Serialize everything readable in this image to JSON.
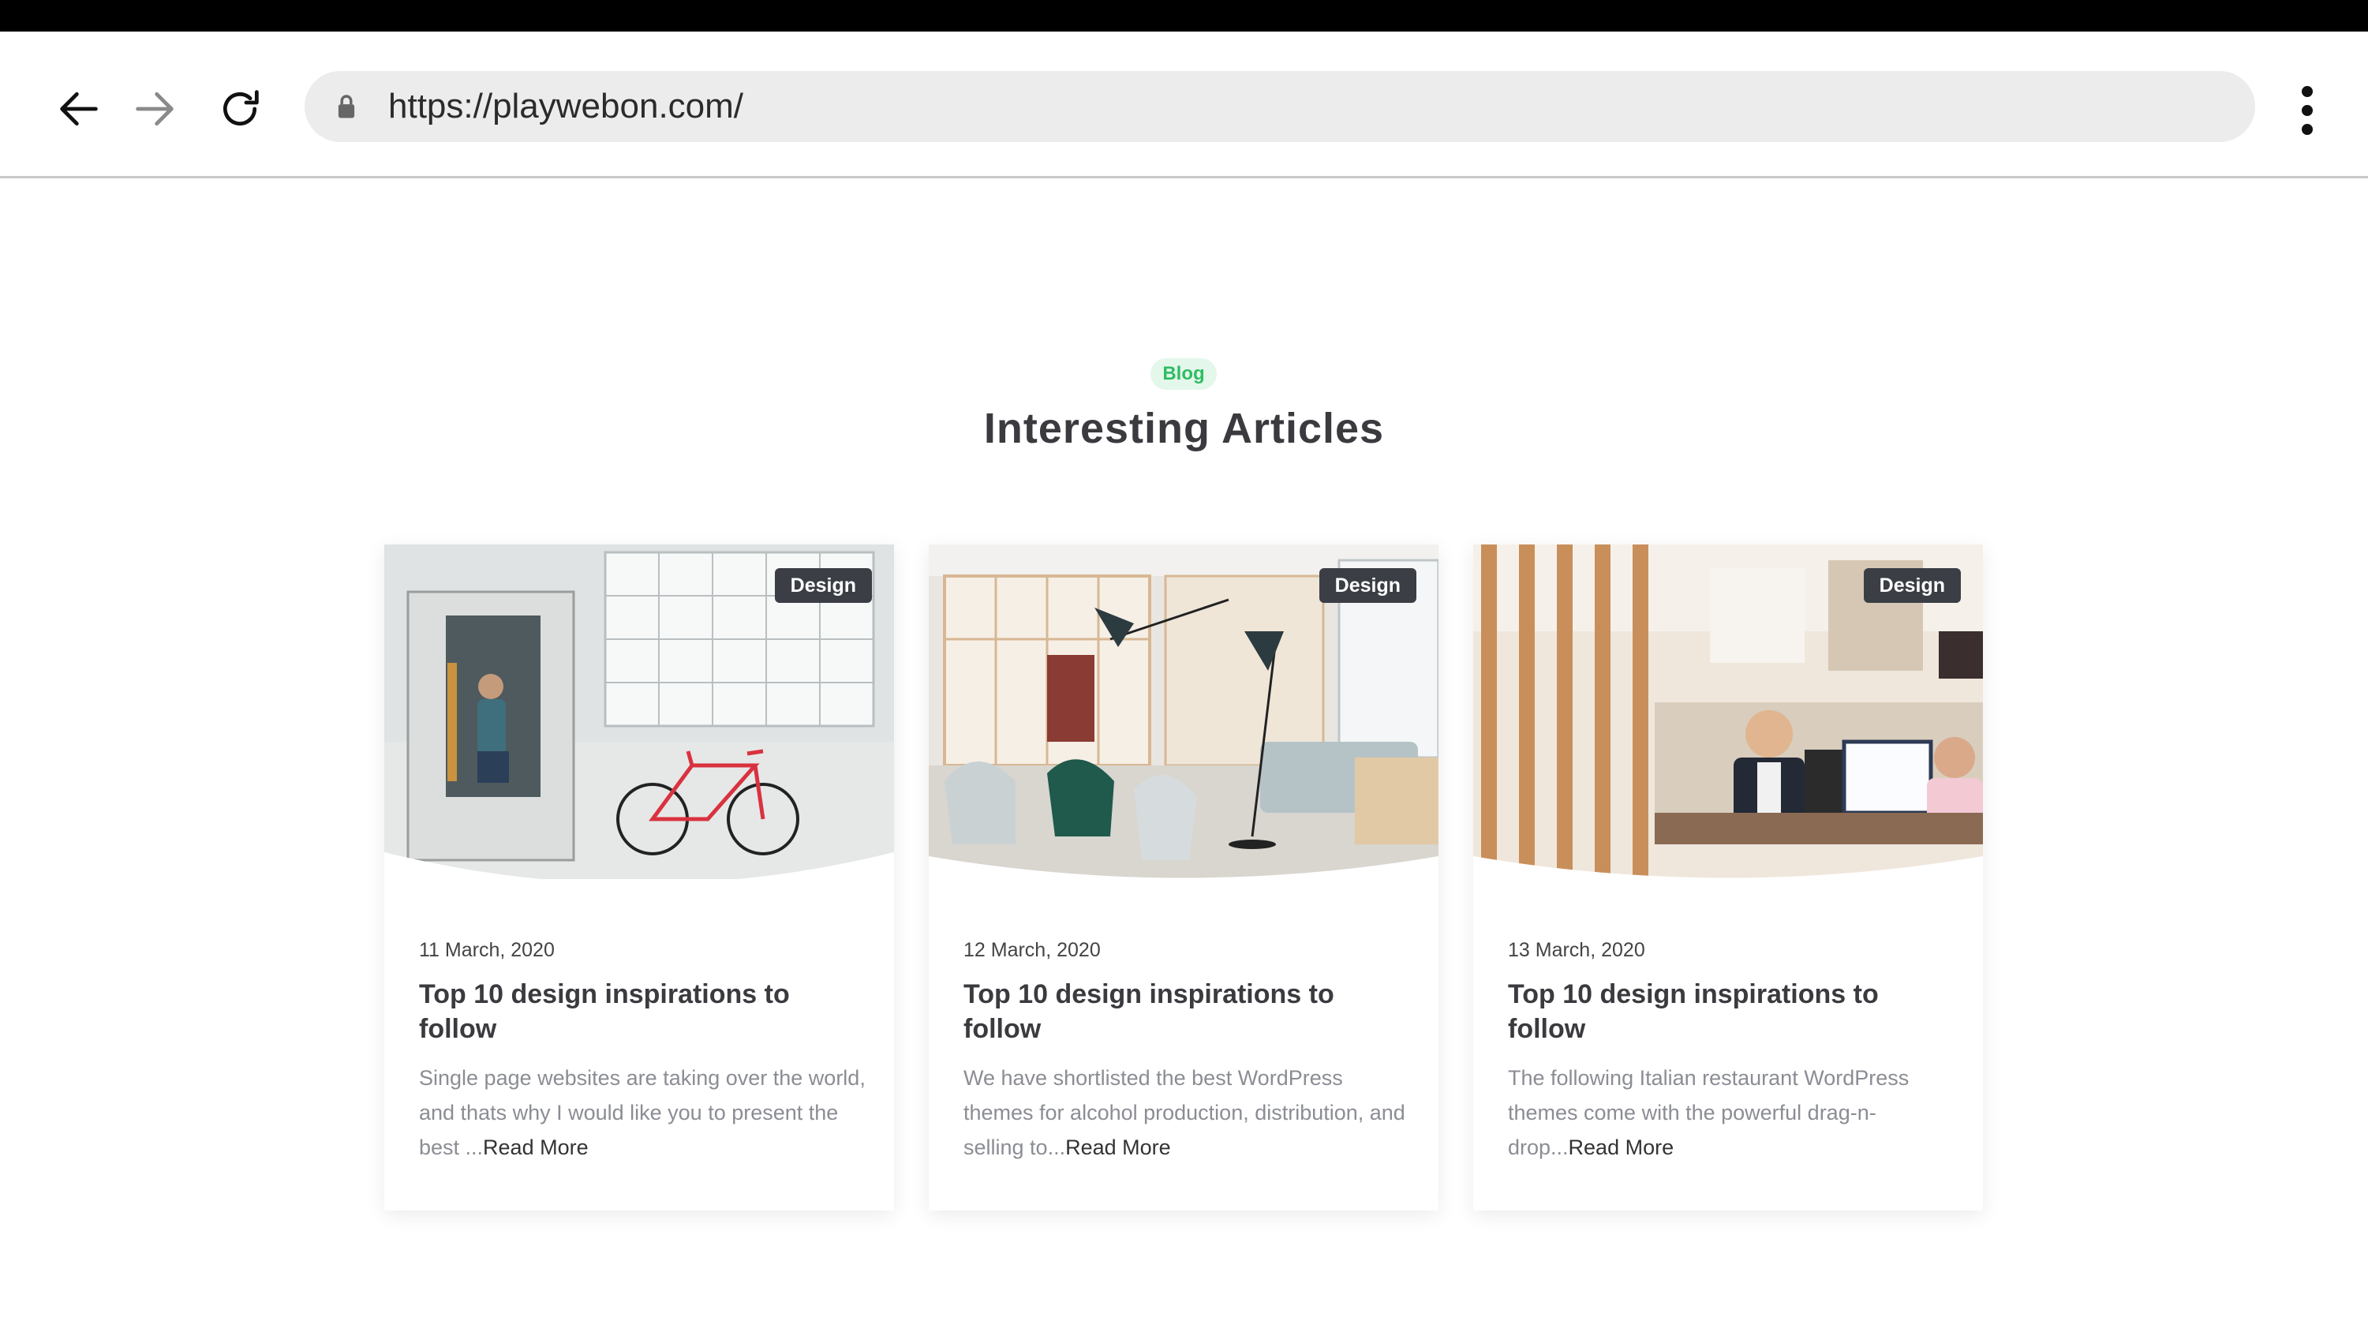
{
  "browser": {
    "url": "https://playwebon.com/",
    "icons": [
      "back-arrow-icon",
      "forward-arrow-icon",
      "reload-icon",
      "lock-icon",
      "more-vertical-icon"
    ]
  },
  "section": {
    "badge": "Blog",
    "title": "Interesting Articles",
    "badge_color": "#2ebd63"
  },
  "cards": [
    {
      "tag": "Design",
      "date": "11 March, 2020",
      "title": "Top 10 design inspirations to follow",
      "excerpt": "Single page websites are taking over the world, and thats why I would like you to present the best ...",
      "read_more": "Read More"
    },
    {
      "tag": "Design",
      "date": "12 March, 2020",
      "title": "Top 10 design inspirations to follow",
      "excerpt": "We have shortlisted the best WordPress themes for alcohol production, distribution, and selling to...",
      "read_more": "Read More"
    },
    {
      "tag": "Design",
      "date": "13 March, 2020",
      "title": "Top 10 design inspirations to follow",
      "excerpt": "The following Italian restaurant WordPress themes come with the powerful drag-n-drop...",
      "read_more": "Read More"
    }
  ]
}
